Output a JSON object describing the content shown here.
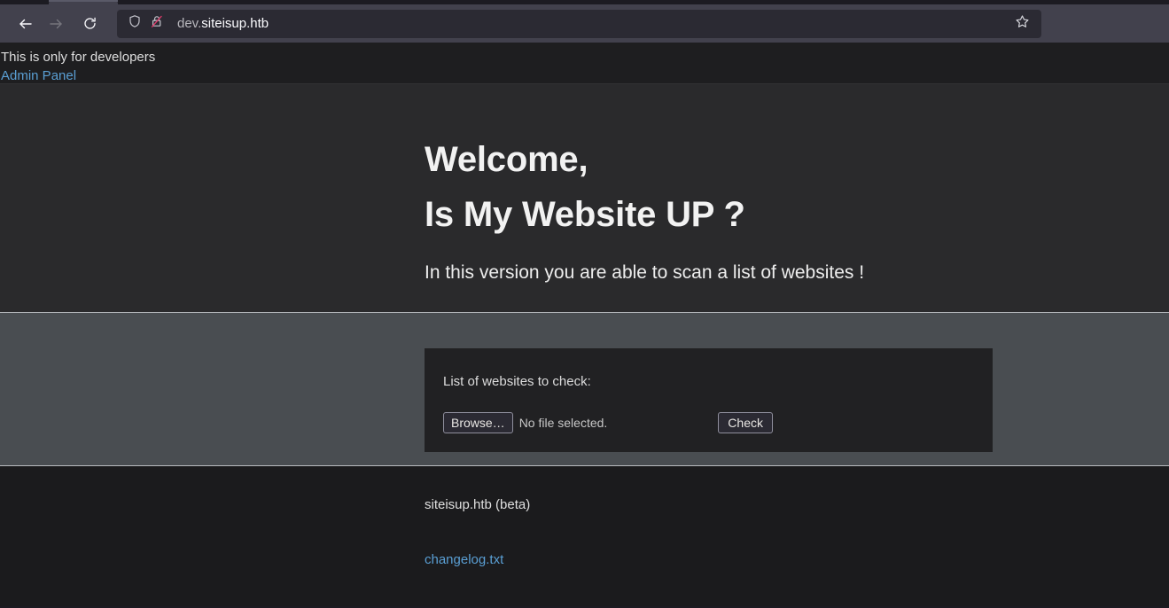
{
  "browser": {
    "back_icon": "back-arrow-icon",
    "forward_icon": "forward-arrow-icon",
    "reload_icon": "reload-icon",
    "shield_icon": "shield-icon",
    "insecure_lock_icon": "crossed-out-lock-icon",
    "bookmark_icon": "bookmark-star-icon",
    "url_prefix": "dev.",
    "url_domain": "siteisup.htb",
    "url_full": "dev.siteisup.htb"
  },
  "dev_banner": {
    "notice": "This is only for developers",
    "admin_link": "Admin Panel"
  },
  "hero": {
    "line1": "Welcome,",
    "line2": "Is My Website UP ?",
    "subtitle": "In this version you are able to scan a list of websites !"
  },
  "form": {
    "label": "List of websites to check:",
    "browse_label": "Browse…",
    "file_status": "No file selected.",
    "submit_label": "Check"
  },
  "footer": {
    "title": "siteisup.htb (beta)",
    "changelog_link": "changelog.txt"
  },
  "colors": {
    "chrome": "#42414d",
    "urlbar": "#2b2a33",
    "banner_bg": "#1e1e20",
    "hero_bg": "#2a2a2c",
    "form_section_bg": "#494d51",
    "card_bg": "#212123",
    "footer_bg": "#1b1b1d",
    "link": "#5a9fd4",
    "divider": "#b9bcc0",
    "text_primary": "#f2f2f2"
  }
}
